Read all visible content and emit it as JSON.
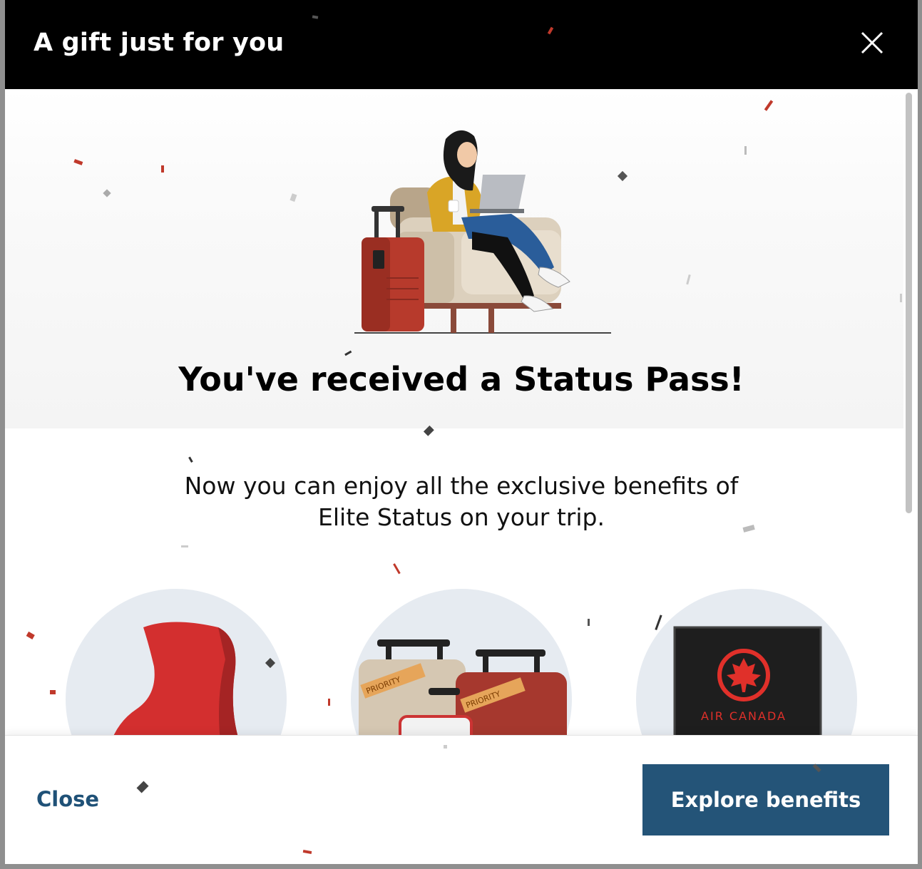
{
  "modal": {
    "title": "A gift just for you",
    "close_icon": "close-icon"
  },
  "hero": {
    "heading": "You've received a Status Pass!",
    "illustration": "woman-in-lounge-chair-illustration"
  },
  "description": {
    "line1": "Now you can enjoy all the exclusive benefits of",
    "line2": "Elite Status on your trip."
  },
  "benefits": [
    {
      "icon": "lounge-chair-icon"
    },
    {
      "icon": "priority-luggage-icon",
      "tag1": "PRIORITY",
      "tag2": "PRIORITY"
    },
    {
      "icon": "air-canada-card-icon",
      "brand": "AIR CANADA"
    }
  ],
  "footer": {
    "close_label": "Close",
    "explore_label": "Explore benefits"
  },
  "colors": {
    "header_bg": "#000000",
    "primary_button": "#245478",
    "link": "#1f5177",
    "accent_red": "#d62b2b"
  }
}
